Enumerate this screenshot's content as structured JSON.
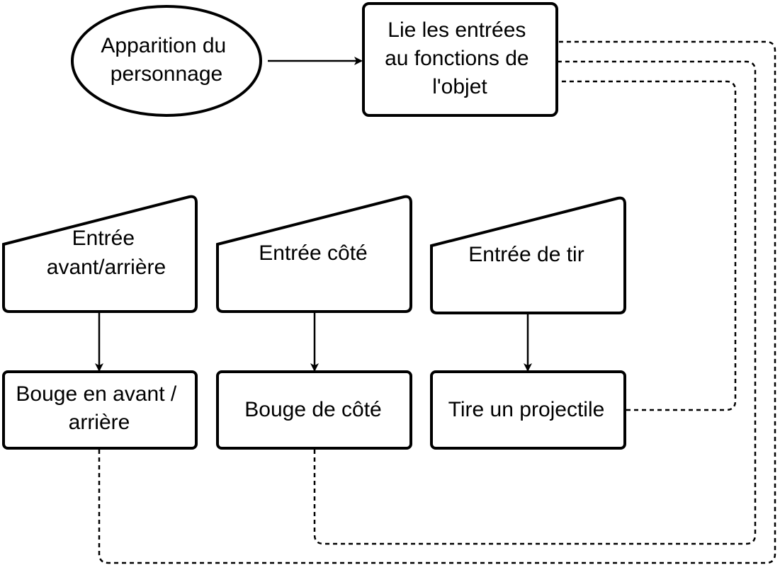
{
  "nodes": {
    "start": {
      "line1": "Apparition du",
      "line2": "personnage"
    },
    "bind": {
      "line1": "Lie les entrées",
      "line2": "au fonctions de",
      "line3": "l'objet"
    },
    "input_forward": {
      "line1": "Entrée",
      "line2": "avant/arrière"
    },
    "input_side": {
      "line1": "Entrée côté"
    },
    "input_fire": {
      "line1": "Entrée de tir"
    },
    "action_forward": {
      "line1": "Bouge en avant /",
      "line2": "arrière"
    },
    "action_side": {
      "line1": "Bouge de côté"
    },
    "action_fire": {
      "line1": "Tire un projectile"
    }
  },
  "colors": {
    "stroke": "#000000",
    "fill": "#ffffff",
    "text": "#000000"
  }
}
